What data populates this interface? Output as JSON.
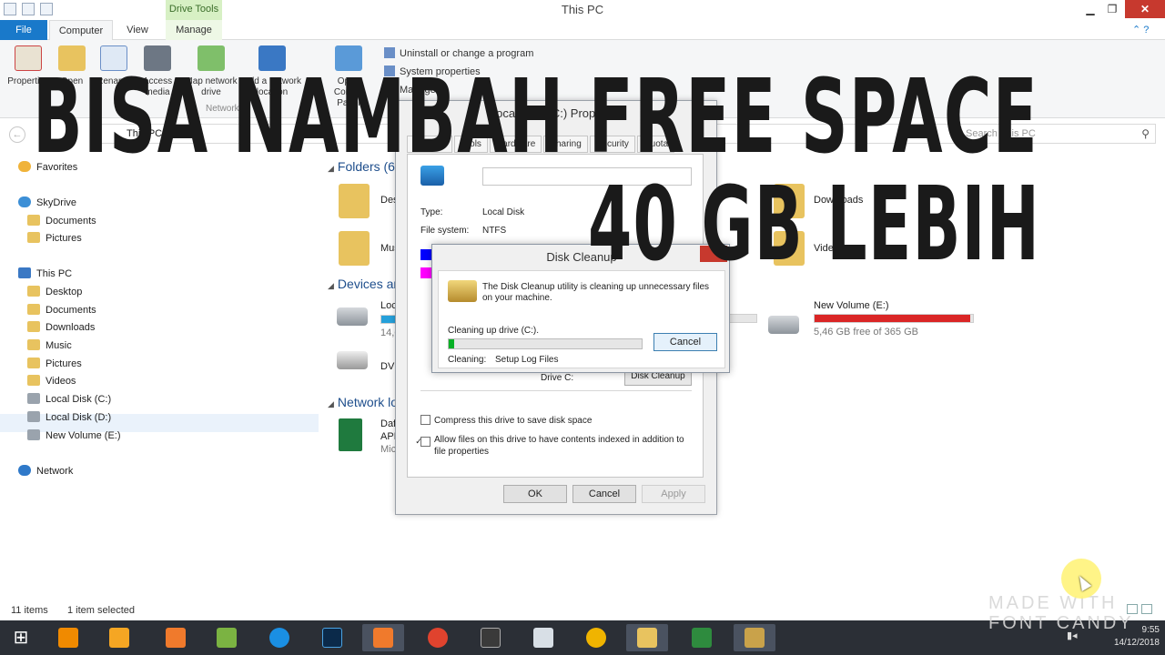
{
  "window": {
    "title": "This PC",
    "context_tab": "Drive Tools",
    "minimize": "▁",
    "maximize": "❐",
    "close": "✕"
  },
  "ribbon": {
    "tabs": {
      "file": "File",
      "computer": "Computer",
      "view": "View",
      "manage": "Manage"
    },
    "buttons": {
      "properties": "Properties",
      "open": "Open",
      "rename": "Rename",
      "access_media": "Access media",
      "map_network_drive": "Map network drive",
      "add_network_location": "Add a network location",
      "open_control_panel": "Open Control Panel"
    },
    "small": {
      "uninstall": "Uninstall or change a program",
      "system_properties": "System properties",
      "manage": "Manage"
    },
    "group_network": "Network"
  },
  "address_bar": {
    "path": "This PC",
    "search_placeholder": "Search This PC"
  },
  "nav": {
    "favorites": "Favorites",
    "skydrive": "SkyDrive",
    "skydrive_documents": "Documents",
    "skydrive_pictures": "Pictures",
    "this_pc": "This PC",
    "desktop": "Desktop",
    "documents": "Documents",
    "downloads": "Downloads",
    "music": "Music",
    "pictures": "Pictures",
    "videos": "Videos",
    "local_disk_c": "Local Disk (C:)",
    "local_disk_d": "Local Disk (D:)",
    "new_volume_e": "New Volume (E:)",
    "network": "Network"
  },
  "content": {
    "group_folders": "Folders (6)",
    "group_devices": "Devices and drives",
    "group_network": "Network locations",
    "desktop": "Desktop",
    "music": "Music",
    "downloads": "Downloads",
    "videos": "Videos",
    "local_disk": "Local Disk (C:)",
    "local_disk_free": "14,6 GB free",
    "dvd": "DVD RW Drive",
    "network_item_1": "Daftar",
    "network_item_2": "API",
    "network_item_3": "Microsoft",
    "new_volume": "New Volume (E:)",
    "new_volume_free": "5,46 GB free of 365 GB",
    "new_volume_used_fraction": 0.985,
    "local_disk_used_fraction": 0.2
  },
  "properties_dialog": {
    "title": "Local Disk (C:) Properties",
    "tabs": [
      "General",
      "Tools",
      "Hardware",
      "Sharing",
      "Security",
      "Quota"
    ],
    "type_label": "Type:",
    "type_value": "Local Disk",
    "fs_label": "File system:",
    "fs_value": "NTFS",
    "drive_label": "Drive C:",
    "disk_cleanup_button": "Disk Cleanup",
    "compress_label": "Compress this drive to save disk space",
    "index_label": "Allow files on this drive to have contents indexed in addition to file properties",
    "index_checked_mark": "✓",
    "ok": "OK",
    "cancel": "Cancel",
    "apply": "Apply",
    "used_color": "#0000ff",
    "free_color": "#ff00ff"
  },
  "cleanup_dialog": {
    "title": "Disk Cleanup",
    "message": "The Disk Cleanup utility is cleaning up unnecessary files on your machine.",
    "drive_line": "Cleaning up drive (C:).",
    "status_label": "Cleaning:",
    "status_value": "Setup Log Files",
    "cancel": "Cancel",
    "progress_fraction": 0.03
  },
  "caption": {
    "line1": "BISA NAMBAH FREE SPACE",
    "line2": "40 GB LEBIH"
  },
  "status_bar": {
    "items": "11 items",
    "selected": "1 item selected"
  },
  "taskbar": {
    "clock_time": "9:55",
    "clock_date": "14/12/2018"
  },
  "watermark": {
    "line1": "MADE WITH",
    "line2": "FONT CANDY"
  },
  "colors": {
    "accent": "#1979ca",
    "drive_bar_full": "#da2626",
    "drive_bar_normal": "#26a0da",
    "progress": "#06b025"
  }
}
